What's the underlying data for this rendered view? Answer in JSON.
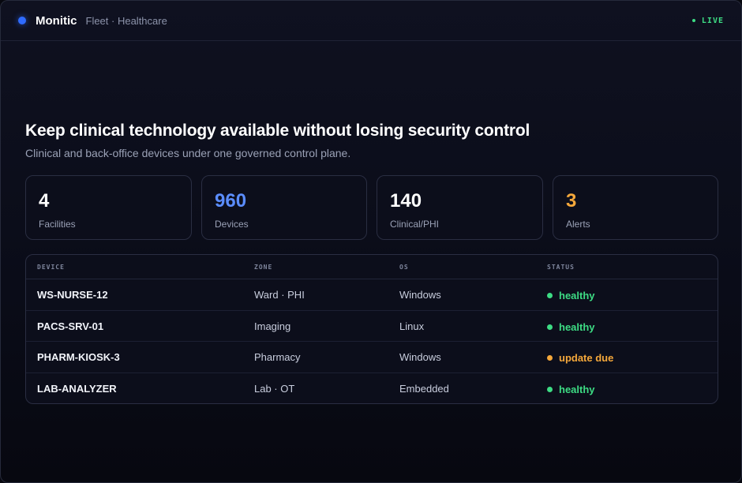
{
  "app": {
    "brand": "Monitic",
    "subtitle": "Fleet · Healthcare",
    "live_label": "LIVE",
    "brand_color": "#2f6bff",
    "live_color": "#3ddc84"
  },
  "hero": {
    "title": "Keep clinical technology available without losing security control",
    "subtitle": "Clinical and back-office devices under one governed control plane."
  },
  "stats": [
    {
      "value": "4",
      "label": "Facilities",
      "color": "#ffffff"
    },
    {
      "value": "960",
      "label": "Devices",
      "color": "#5b8dff"
    },
    {
      "value": "140",
      "label": "Clinical/PHI",
      "color": "#ffffff"
    },
    {
      "value": "3",
      "label": "Alerts",
      "color": "#f5a83b"
    }
  ],
  "table": {
    "headers": [
      "DEVICE",
      "ZONE",
      "OS",
      "STATUS"
    ],
    "rows": [
      {
        "device": "WS-NURSE-12",
        "zone": "Ward · PHI",
        "os": "Windows",
        "status": "healthy",
        "status_color": "#3ddc84"
      },
      {
        "device": "PACS-SRV-01",
        "zone": "Imaging",
        "os": "Linux",
        "status": "healthy",
        "status_color": "#3ddc84"
      },
      {
        "device": "PHARM-KIOSK-3",
        "zone": "Pharmacy",
        "os": "Windows",
        "status": "update due",
        "status_color": "#f5a83b"
      },
      {
        "device": "LAB-ANALYZER",
        "zone": "Lab · OT",
        "os": "Embedded",
        "status": "healthy",
        "status_color": "#3ddc84"
      }
    ]
  }
}
